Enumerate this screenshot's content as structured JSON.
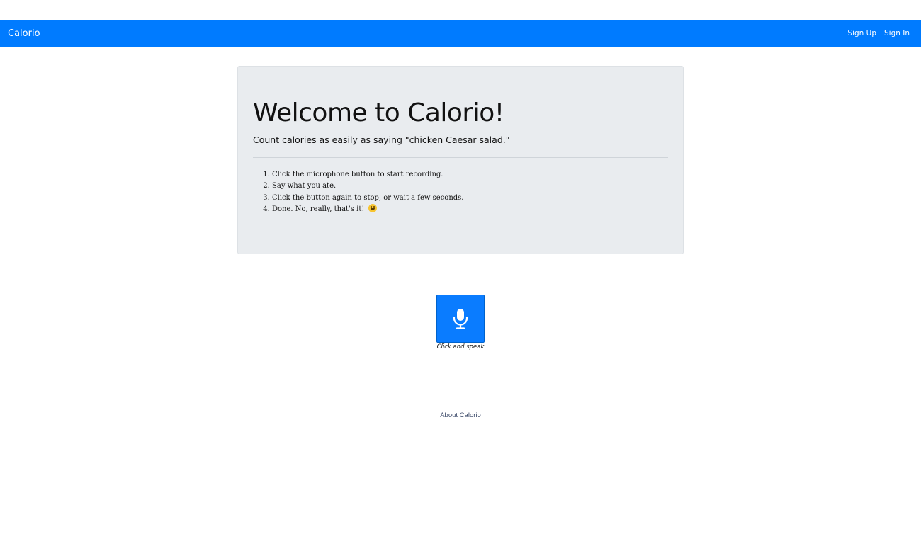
{
  "navbar": {
    "brand": "Calorio",
    "links": [
      "Sign Up",
      "Sign In"
    ]
  },
  "jumbotron": {
    "title": "Welcome to Calorio!",
    "lead": "Count calories as easily as saying \"chicken Caesar salad.\"",
    "steps": [
      "Click the microphone button to start recording.",
      "Say what you ate.",
      "Click the button again to stop, or wait a few seconds.",
      "Done. No, really, that's it!"
    ],
    "emoji_icon": "grinning-face-icon"
  },
  "recorder": {
    "icon": "microphone-icon",
    "caption": "Click and speak",
    "button_color": "#0a7cff"
  },
  "footer": {
    "link": "About Calorio"
  },
  "colors": {
    "primary": "#007bff",
    "jumbotron_bg": "#e9ecef"
  }
}
